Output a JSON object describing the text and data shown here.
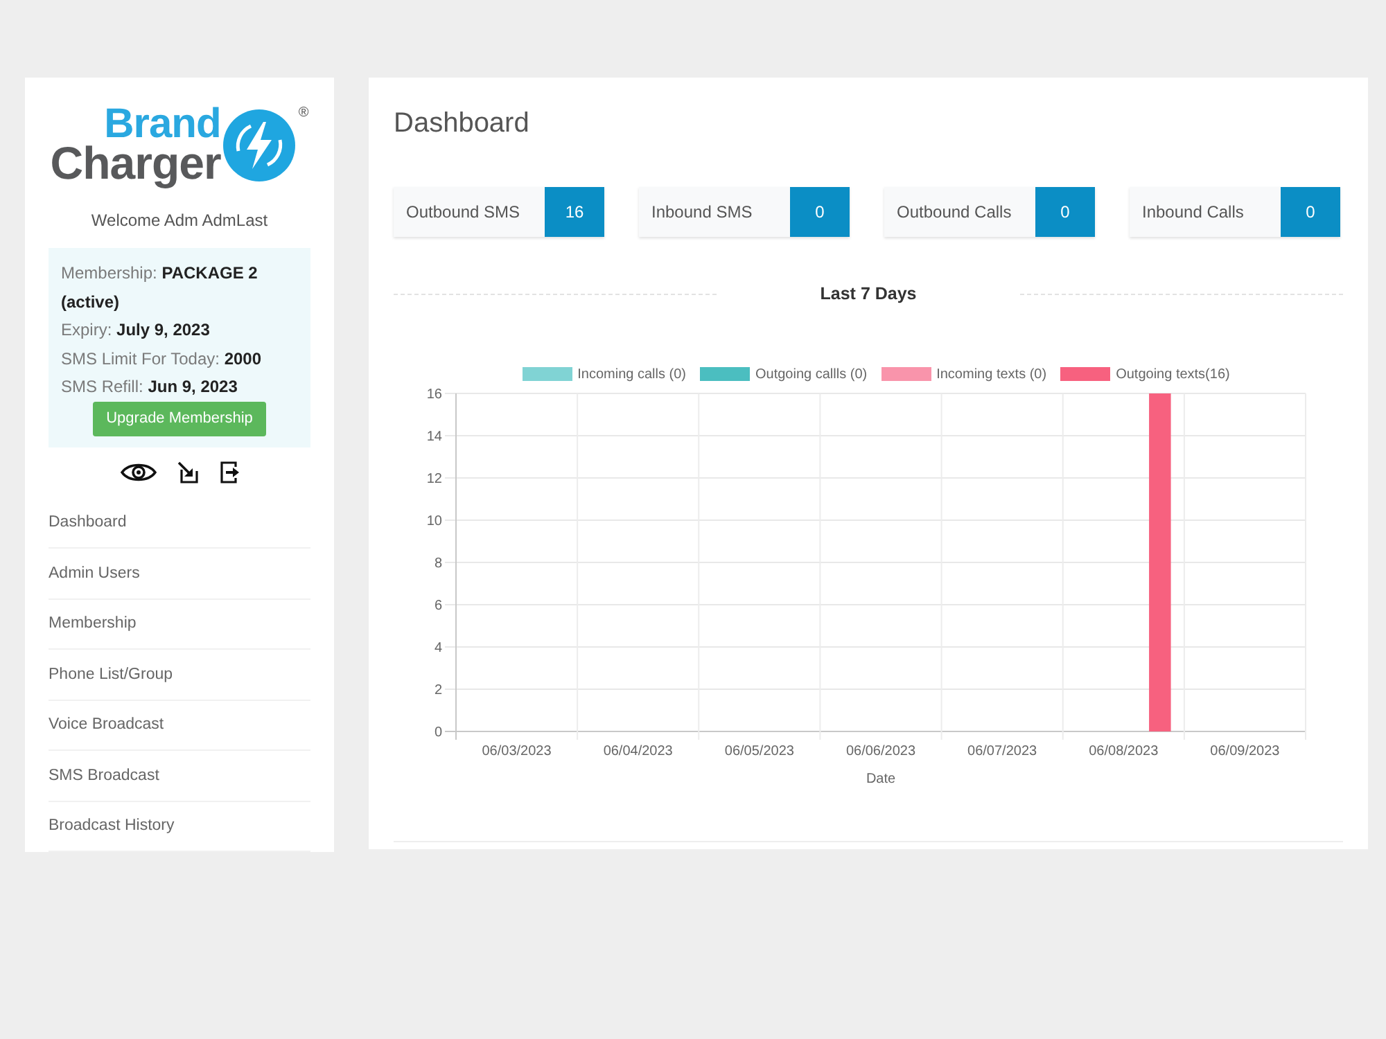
{
  "sidebar": {
    "logo": {
      "top_word": "Brand",
      "bottom_word": "Charger",
      "registered_mark": "®"
    },
    "welcome": "Welcome Adm AdmLast",
    "membership": {
      "lines": [
        "Membership: **PACKAGE 2 (active)**",
        "Expiry: **July 9, 2023**",
        "SMS Limit For Today: **2000**",
        "SMS Refill: **Jun 9, 2023**"
      ],
      "button": "Upgrade Membership"
    },
    "nav": [
      "Dashboard",
      "Admin Users",
      "Membership",
      "Phone List/Group",
      "Voice Broadcast",
      "SMS Broadcast",
      "Broadcast History"
    ]
  },
  "main": {
    "title": "Dashboard",
    "stats": [
      {
        "label": "Outbound SMS",
        "value": "16"
      },
      {
        "label": "Inbound SMS",
        "value": "0"
      },
      {
        "label": "Outbound Calls",
        "value": "0"
      },
      {
        "label": "Inbound Calls",
        "value": "0"
      }
    ],
    "section_title": "Last 7 Days",
    "chart_data": {
      "type": "bar",
      "xlabel": "Date",
      "categories": [
        "06/03/2023",
        "06/04/2023",
        "06/05/2023",
        "06/06/2023",
        "06/07/2023",
        "06/08/2023",
        "06/09/2023"
      ],
      "series": [
        {
          "name": "Incoming calls (0)",
          "color": "#80d3d4",
          "values": [
            0,
            0,
            0,
            0,
            0,
            0,
            0
          ]
        },
        {
          "name": "Outgoing callls (0)",
          "color": "#4bbec0",
          "values": [
            0,
            0,
            0,
            0,
            0,
            0,
            0
          ]
        },
        {
          "name": "Incoming texts (0)",
          "color": "#f994ab",
          "values": [
            0,
            0,
            0,
            0,
            0,
            0,
            0
          ]
        },
        {
          "name": "Outgoing texts(16)",
          "color": "#f7617f",
          "values": [
            0,
            0,
            0,
            0,
            0,
            16,
            0
          ]
        }
      ],
      "ylim": [
        0,
        16
      ],
      "yticks": [
        0,
        2,
        4,
        6,
        8,
        10,
        12,
        14,
        16
      ],
      "grid": true
    }
  }
}
